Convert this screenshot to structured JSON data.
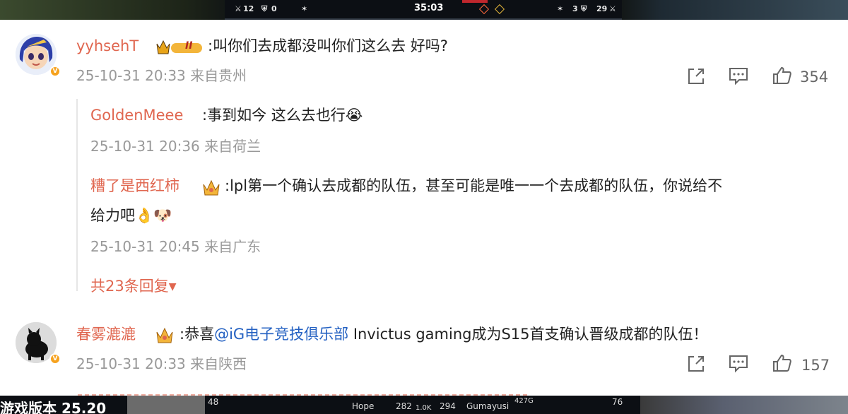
{
  "game_top": {
    "left_kills": "12",
    "left_towers": "0",
    "clock": "35:03",
    "right_towers": "3",
    "right_kills": "29"
  },
  "comments": [
    {
      "user": "yyhsehT",
      "level_badge": "II",
      "text": ":叫你们去成都没叫你们这么去 好吗?",
      "time": "25-10-31 20:33",
      "location": "来自贵州",
      "likes": "354"
    },
    {
      "user": "春雾漉漉",
      "text_prefix": ":恭喜",
      "mention": "@iG电子竞技俱乐部",
      "text_suffix": " Invictus gaming成为S15首支确认晋级成都的队伍！",
      "time": "25-10-31 20:33",
      "location": "来自陕西",
      "likes": "157"
    }
  ],
  "replies": [
    {
      "user": "GoldenMeee",
      "text": ":事到如今 这么去也行",
      "emoji": "😭",
      "time": "25-10-31 20:36",
      "location": "来自荷兰"
    },
    {
      "user": "糟了是西红柿",
      "text_line1": ":lpl第一个确认去成都的队伍，甚至可能是唯一一个去成都的队伍，你说给不",
      "text_line2": "给力吧",
      "emoji": "👌🐶",
      "time": "25-10-31 20:45",
      "location": "来自广东"
    }
  ],
  "more_replies": "共23条回复",
  "game_bottom": {
    "left_title": "游戏版本 25.20",
    "p1_level": "48",
    "p1_name": "Hope",
    "p1_cs": "282",
    "gold_diff": "1.0K",
    "p2_cs": "294",
    "p2_name": "Gumayusi",
    "p2_gold": "427G",
    "p2_level": "76"
  },
  "colors": {
    "username": "#e0664f",
    "mention": "#2461c2",
    "meta": "#999999",
    "vip_badge": "#f6a21e"
  },
  "icons": [
    "share-icon",
    "comment-icon",
    "like-icon",
    "crown-icon",
    "chevron-down-icon"
  ]
}
